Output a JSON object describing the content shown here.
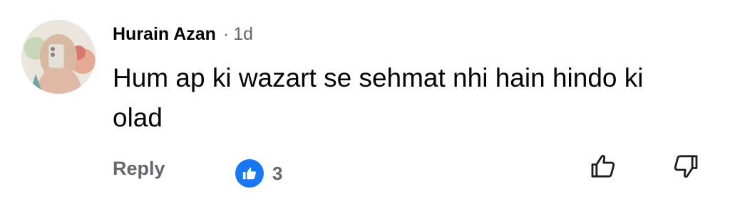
{
  "comment": {
    "author": "Hurain Azan",
    "separator": "·",
    "time": "1d",
    "text": "Hum ap ki wazart se sehmat nhi hain hindo ki olad",
    "reply_label": "Reply",
    "like_count": "3"
  },
  "icons": {
    "avatar": "profile-photo",
    "reaction": "thumbs-up-icon",
    "upvote": "thumbs-up-outline-icon",
    "downvote": "thumbs-down-outline-icon"
  },
  "colors": {
    "accent": "#1877f2",
    "muted_text": "#65676b",
    "primary_text": "#050505"
  }
}
